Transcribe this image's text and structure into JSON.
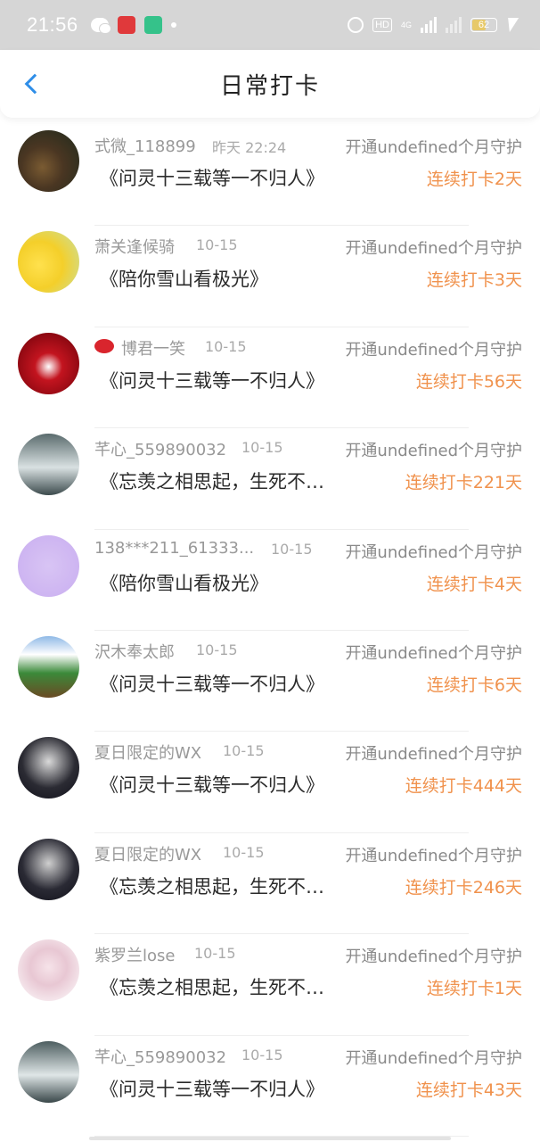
{
  "status_bar": {
    "time": "21:56",
    "hd_label": "HD",
    "network_label": "4G",
    "battery": "62",
    "battery_level": 0.62,
    "colors": {
      "background": "#d6d6d6",
      "battery_fill": "#e7c96a"
    }
  },
  "header": {
    "title": "日常打卡",
    "back_icon": "chevron-left-icon",
    "accent": "#2f8ee8"
  },
  "guard_prefix": "开通undefined个月守护",
  "colors": {
    "streak": "#f0924d",
    "name": "#999999",
    "message": "#2b2b2b"
  },
  "items": [
    {
      "name": "式微_118899",
      "date": "昨天 22:24",
      "guard": "开通undefined个月守护",
      "message": "《问灵十三载等一不归人》",
      "streak": "连续打卡2天"
    },
    {
      "name": "萧关逢候骑",
      "date": "10-15",
      "guard": "开通undefined个月守护",
      "message": "《陪你雪山看极光》",
      "streak": "连续打卡3天"
    },
    {
      "name": "博君一笑",
      "date": "10-15",
      "guard": "开通undefined个月守护",
      "message": "《问灵十三载等一不归人》",
      "streak": "连续打卡56天",
      "name_icon": "lips-icon"
    },
    {
      "name": "芊心_559890032",
      "date": "10-15",
      "guard": "开通undefined个月守护",
      "message": "《忘羡之相思起，生死不离》",
      "streak": "连续打卡221天"
    },
    {
      "name": "138***211_61333...",
      "date": "10-15",
      "guard": "开通undefined个月守护",
      "message": "《陪你雪山看极光》",
      "streak": "连续打卡4天"
    },
    {
      "name": "沢木奉太郎",
      "date": "10-15",
      "guard": "开通undefined个月守护",
      "message": "《问灵十三载等一不归人》",
      "streak": "连续打卡6天"
    },
    {
      "name": "夏日限定的WX",
      "date": "10-15",
      "guard": "开通undefined个月守护",
      "message": "《问灵十三载等一不归人》",
      "streak": "连续打卡444天"
    },
    {
      "name": "夏日限定的WX",
      "date": "10-15",
      "guard": "开通undefined个月守护",
      "message": "《忘羡之相思起，生死不离》",
      "streak": "连续打卡246天"
    },
    {
      "name": "紫罗兰lose",
      "date": "10-15",
      "guard": "开通undefined个月守护",
      "message": "《忘羡之相思起，生死不离》",
      "streak": "连续打卡1天"
    },
    {
      "name": "芊心_559890032",
      "date": "10-15",
      "guard": "开通undefined个月守护",
      "message": "《问灵十三载等一不归人》",
      "streak": "连续打卡43天"
    }
  ]
}
